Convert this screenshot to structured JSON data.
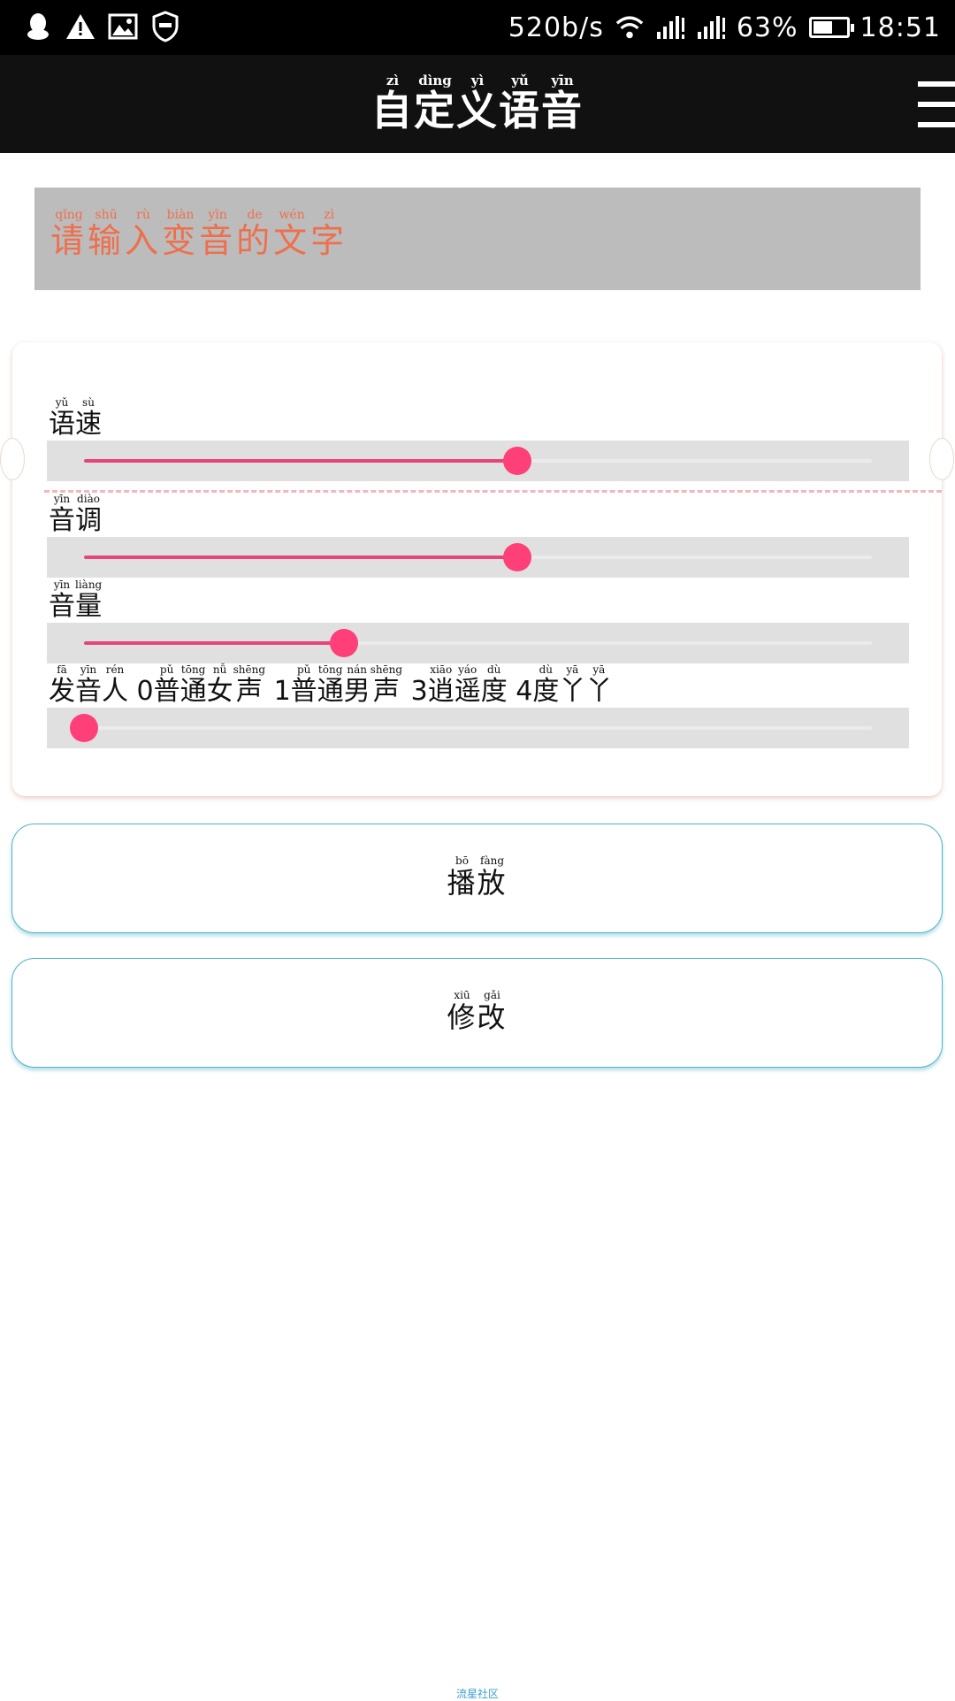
{
  "status_bar": {
    "network_speed": "520b/s",
    "battery_percent": "63%",
    "battery_level": 0.63,
    "time": "18:51",
    "icons": [
      "qq-icon",
      "warning-icon",
      "image-icon",
      "shield-icon",
      "wifi-icon",
      "signal-icon",
      "signal-icon",
      "battery-icon"
    ]
  },
  "header": {
    "title": [
      {
        "char": "自",
        "pinyin": "zì"
      },
      {
        "char": "定",
        "pinyin": "dìng"
      },
      {
        "char": "义",
        "pinyin": "yì"
      },
      {
        "char": "语",
        "pinyin": "yǔ"
      },
      {
        "char": "音",
        "pinyin": "yīn"
      }
    ],
    "menu_icon": "hamburger-menu-icon"
  },
  "text_input": {
    "placeholder": [
      {
        "char": "请",
        "pinyin": "qǐng"
      },
      {
        "char": "输",
        "pinyin": "shū"
      },
      {
        "char": "入",
        "pinyin": "rù"
      },
      {
        "char": "变",
        "pinyin": "biàn"
      },
      {
        "char": "音",
        "pinyin": "yīn"
      },
      {
        "char": "的",
        "pinyin": "de"
      },
      {
        "char": "文",
        "pinyin": "wén"
      },
      {
        "char": "字",
        "pinyin": "zì"
      }
    ],
    "placeholder_color": "#ef6f4c",
    "background": "#bcbcbc"
  },
  "controls": {
    "speed": {
      "label": [
        {
          "char": "语",
          "pinyin": "yǔ"
        },
        {
          "char": "速",
          "pinyin": "sù"
        }
      ],
      "value": 0.55
    },
    "pitch": {
      "label": [
        {
          "char": "音",
          "pinyin": "yīn"
        },
        {
          "char": "调",
          "pinyin": "diào"
        }
      ],
      "value": 0.55
    },
    "volume": {
      "label": [
        {
          "char": "音",
          "pinyin": "yīn"
        },
        {
          "char": "量",
          "pinyin": "liàng"
        }
      ],
      "value": 0.33
    },
    "speaker": {
      "label": [
        {
          "char": "发",
          "pinyin": "fā"
        },
        {
          "char": "音",
          "pinyin": "yīn"
        },
        {
          "char": "人",
          "pinyin": "rén"
        },
        {
          "char": " 0",
          "pinyin": ""
        },
        {
          "char": "普",
          "pinyin": "pǔ"
        },
        {
          "char": "通",
          "pinyin": "tōng"
        },
        {
          "char": "女",
          "pinyin": "nǚ"
        },
        {
          "char": "声",
          "pinyin": "shēng"
        },
        {
          "char": " 1",
          "pinyin": ""
        },
        {
          "char": "普",
          "pinyin": "pǔ"
        },
        {
          "char": "通",
          "pinyin": "tōng"
        },
        {
          "char": "男",
          "pinyin": "nán"
        },
        {
          "char": "声",
          "pinyin": "shēng"
        },
        {
          "char": " 3",
          "pinyin": ""
        },
        {
          "char": "逍",
          "pinyin": "xiāo"
        },
        {
          "char": "遥",
          "pinyin": "yáo"
        },
        {
          "char": "度",
          "pinyin": "dù"
        },
        {
          "char": " 4",
          "pinyin": ""
        },
        {
          "char": "度",
          "pinyin": "dù"
        },
        {
          "char": "丫",
          "pinyin": "yā"
        },
        {
          "char": "丫",
          "pinyin": "yā"
        }
      ],
      "value": 0
    }
  },
  "buttons": {
    "play": [
      {
        "char": "播",
        "pinyin": "bō"
      },
      {
        "char": "放",
        "pinyin": "fàng"
      }
    ],
    "modify": [
      {
        "char": "修",
        "pinyin": "xiū"
      },
      {
        "char": "改",
        "pinyin": "gǎi"
      }
    ]
  },
  "footer": {
    "watermark": "流星社区"
  },
  "colors": {
    "accent": "#ff3f77",
    "button_border": "#51b3c9",
    "header_bg": "#111111"
  }
}
